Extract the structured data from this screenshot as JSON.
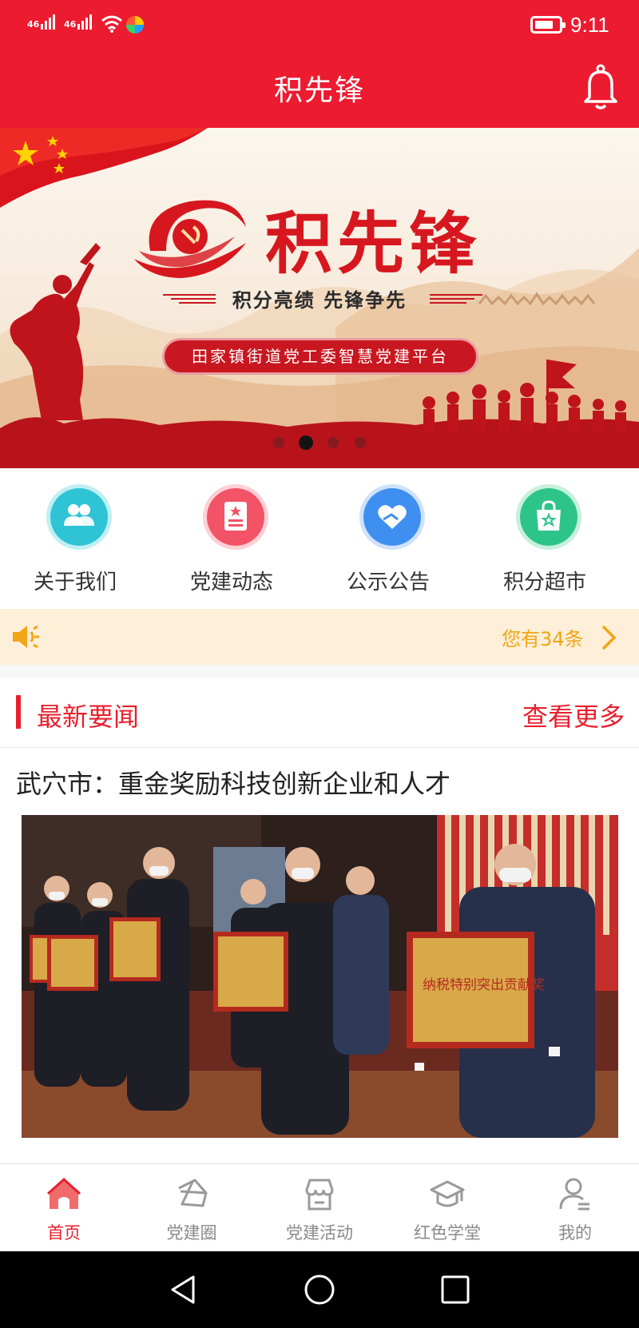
{
  "status_bar": {
    "signal_1": "46",
    "signal_2": "46",
    "time": "9:11",
    "icons": [
      "signal-icon",
      "wifi-icon",
      "app-icon",
      "battery-icon"
    ]
  },
  "header": {
    "title": "积先锋",
    "bell_icon": "bell-icon",
    "background": "#ec1b30"
  },
  "banner": {
    "title": "积先锋",
    "slogan": "积分亮绩 先锋争先",
    "subtitle": "田家镇街道党工委智慧党建平台",
    "dots_total": 4,
    "active_dot": 2
  },
  "quick_entries": [
    {
      "label": "关于我们",
      "icon": "users-icon",
      "color": "#2ec4d6"
    },
    {
      "label": "党建动态",
      "icon": "document-star-icon",
      "color": "#f25366"
    },
    {
      "label": "公示公告",
      "icon": "heart-hand-icon",
      "color": "#3f8ff0"
    },
    {
      "label": "积分超市",
      "icon": "shopping-bag-icon",
      "color": "#2dc48a"
    }
  ],
  "notice": {
    "icon": "speaker-icon",
    "text": "您有34条"
  },
  "news": {
    "section_title": "最新要闻",
    "more_label": "查看更多",
    "headline": "武穴市：重金奖励科技创新企业和人才",
    "plaque_text": "纳税特别突出贡献奖"
  },
  "tabbar": {
    "items": [
      {
        "label": "首页",
        "icon": "home-icon",
        "active": true
      },
      {
        "label": "党建圈",
        "icon": "circle-share-icon",
        "active": false
      },
      {
        "label": "党建活动",
        "icon": "store-icon",
        "active": false
      },
      {
        "label": "红色学堂",
        "icon": "graduation-cap-icon",
        "active": false
      },
      {
        "label": "我的",
        "icon": "user-icon",
        "active": false
      }
    ]
  }
}
